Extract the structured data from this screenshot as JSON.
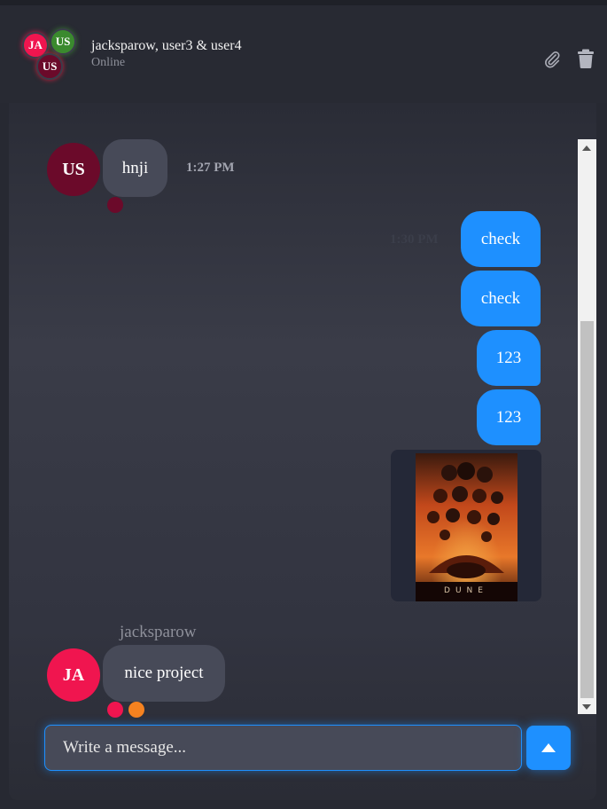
{
  "header": {
    "avatars": [
      "JA",
      "US",
      "US"
    ],
    "group_name": "jacksparow, user3 & user4",
    "status": "Online",
    "icons": [
      "paperclip-icon",
      "trash-icon"
    ]
  },
  "messages": [
    {
      "type": "incoming",
      "avatar": "US",
      "text": "hnji",
      "time": "1:27 PM"
    },
    {
      "type": "outgoing",
      "text": "check",
      "time": "1:30 PM"
    },
    {
      "type": "outgoing",
      "text": "check"
    },
    {
      "type": "outgoing",
      "text": "123"
    },
    {
      "type": "outgoing",
      "text": "123"
    },
    {
      "type": "outgoing-image",
      "image": "movie-poster"
    },
    {
      "type": "incoming",
      "sender": "jacksparow",
      "avatar": "JA",
      "text": "nice project"
    }
  ],
  "composer": {
    "placeholder": "Write a message...",
    "send_icon": "send-arrow-up-icon"
  },
  "colors": {
    "accent": "#1e90ff",
    "incoming_bubble": "#474a58",
    "avatar_ja": "#f0154f",
    "avatar_us_green": "#3a8a2e",
    "avatar_us_dark": "#6b0a2a",
    "seen_dot_pink": "#f0154f",
    "seen_dot_orange": "#f58220"
  }
}
